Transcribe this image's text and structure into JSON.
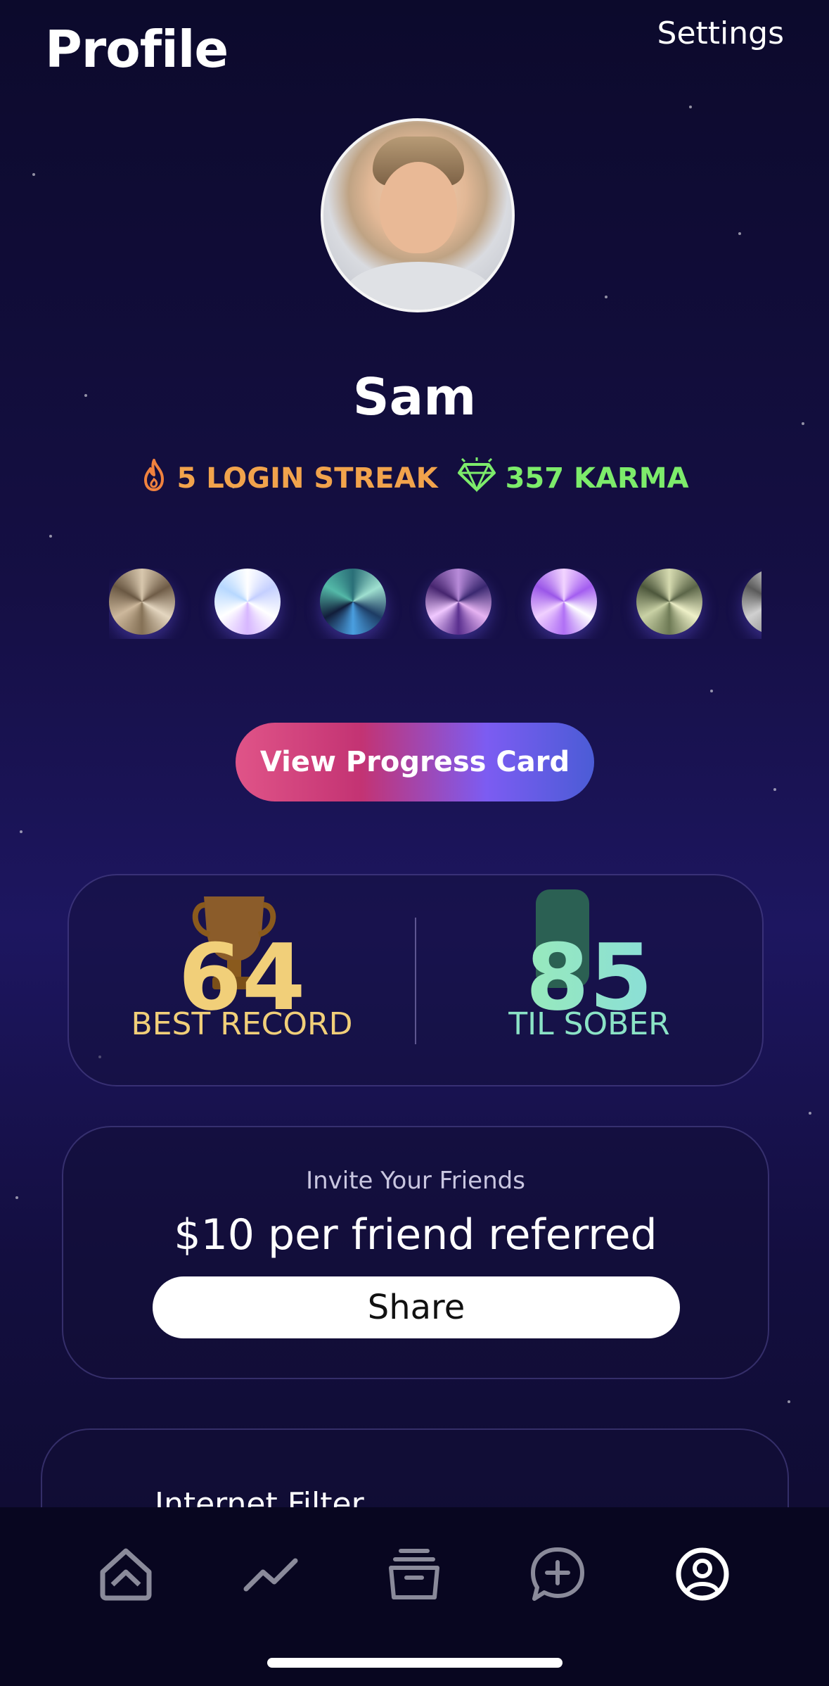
{
  "header": {
    "title": "Profile",
    "settings_label": "Settings"
  },
  "user": {
    "name": "Sam"
  },
  "stats": {
    "streak_label": "5 LOGIN STREAK",
    "karma_label": "357 KARMA"
  },
  "badge_colors": [
    "#b8a48a",
    "#e8ecff",
    "#3a8f8f",
    "#9a5fb6",
    "#c79bf5",
    "#8d9a72",
    "#b5b5b5"
  ],
  "progress_button": {
    "label": "View Progress Card"
  },
  "records": {
    "best_value": "64",
    "best_label": "BEST RECORD",
    "sober_value": "85",
    "sober_label": "TIL SOBER"
  },
  "invite": {
    "subtitle": "Invite Your Friends",
    "title": "$10 per friend referred",
    "share_label": "Share"
  },
  "filter": {
    "title": "Internet Filter"
  },
  "tabbar": {
    "items": [
      {
        "name": "home-tab",
        "icon": "home-icon"
      },
      {
        "name": "progress-tab",
        "icon": "trend-icon"
      },
      {
        "name": "library-tab",
        "icon": "archive-icon"
      },
      {
        "name": "chat-tab",
        "icon": "chat-plus-icon"
      },
      {
        "name": "profile-tab",
        "icon": "user-circle-icon"
      }
    ]
  },
  "colors": {
    "streak": "#f1a34c",
    "karma": "#7dec6b",
    "gold": "#f1cf79",
    "teal": "#8be3c6"
  }
}
